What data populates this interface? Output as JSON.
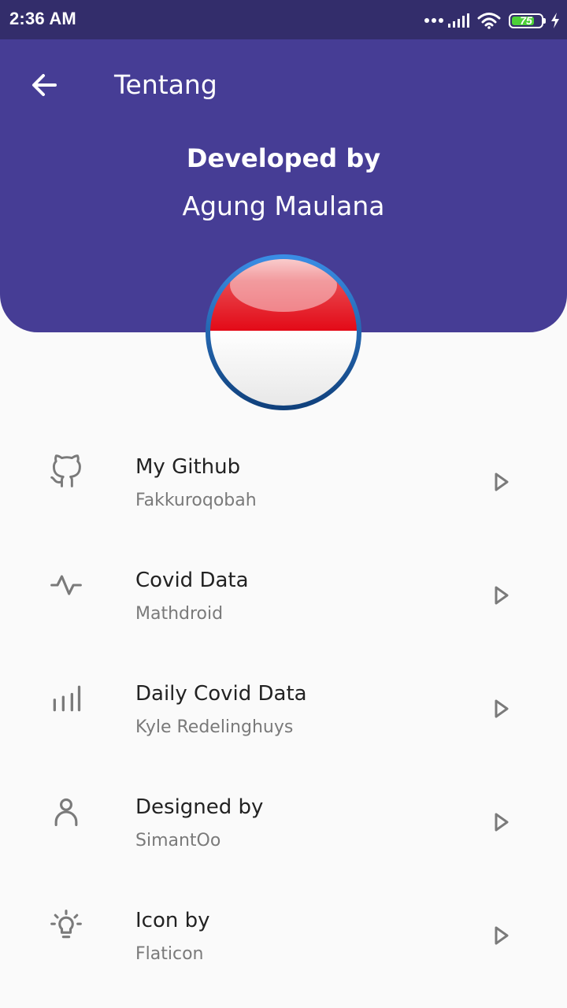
{
  "status_bar": {
    "time": "2:36 AM",
    "battery_level": "75",
    "icons": [
      "more-dots-icon",
      "signal-icon",
      "wifi-icon",
      "battery-icon",
      "charging-icon"
    ]
  },
  "header": {
    "title": "Tentang",
    "back_icon": "arrow-left-icon",
    "developed_label": "Developed by",
    "developer_name": "Agung Maulana",
    "avatar": "indonesia-flag-icon"
  },
  "items": [
    {
      "title": "My Github",
      "subtitle": "Fakkuroqobah",
      "icon": "github-icon"
    },
    {
      "title": "Covid Data",
      "subtitle": "Mathdroid",
      "icon": "activity-icon"
    },
    {
      "title": "Daily Covid Data",
      "subtitle": "Kyle Redelinghuys",
      "icon": "bar-chart-icon"
    },
    {
      "title": "Designed by",
      "subtitle": "SimantOo",
      "icon": "user-icon"
    },
    {
      "title": "Icon by",
      "subtitle": "Flaticon",
      "icon": "lightbulb-icon"
    }
  ],
  "colors": {
    "status_bar": "#332d6b",
    "header": "#463d95",
    "background": "#fafafa",
    "title_text": "#222222",
    "subtitle_text": "#7a7a7a",
    "icon": "#7a7a7a",
    "flag_red": "#e30a17",
    "flag_border": "#1f6fc9"
  }
}
